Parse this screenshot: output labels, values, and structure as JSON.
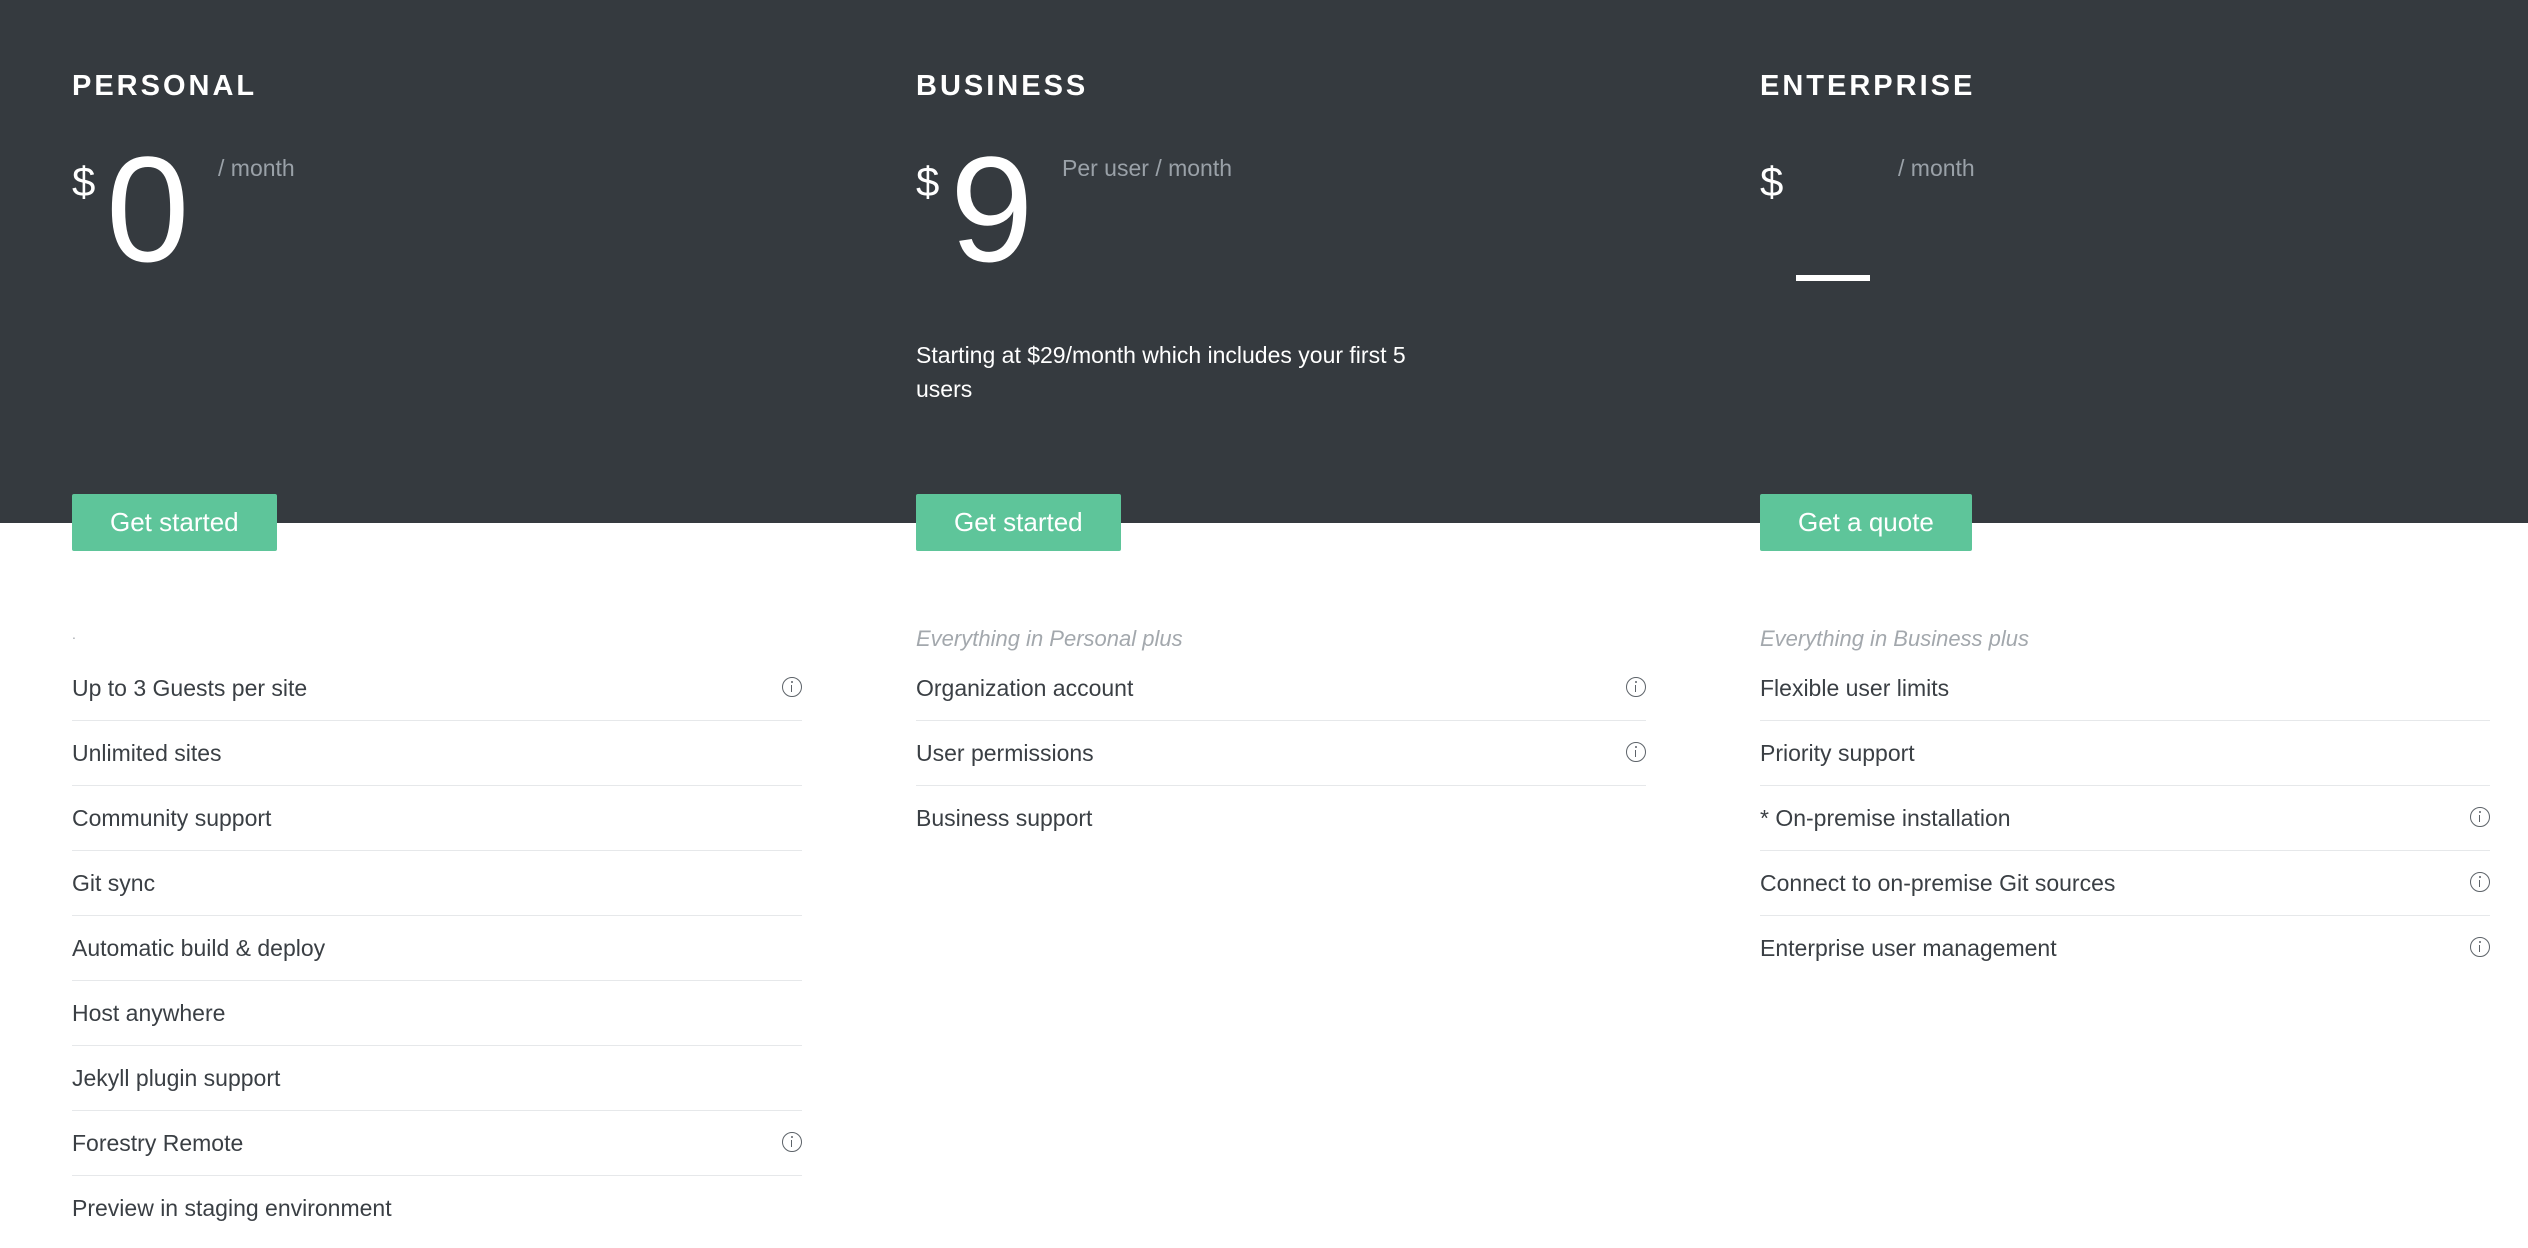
{
  "plans": [
    {
      "name": "PERSONAL",
      "currency": "$",
      "amount": "0",
      "period": "/ month",
      "note": "",
      "cta_label": "Get started",
      "features_intro": ".",
      "features": [
        {
          "label": "Up to 3 Guests per site",
          "info": true
        },
        {
          "label": "Unlimited sites",
          "info": false
        },
        {
          "label": "Community support",
          "info": false
        },
        {
          "label": "Git sync",
          "info": false
        },
        {
          "label": "Automatic build & deploy",
          "info": false
        },
        {
          "label": "Host anywhere",
          "info": false
        },
        {
          "label": "Jekyll plugin support",
          "info": false
        },
        {
          "label": "Forestry Remote",
          "info": true
        },
        {
          "label": "Preview in staging environment",
          "info": false
        }
      ]
    },
    {
      "name": "BUSINESS",
      "currency": "$",
      "amount": "9",
      "period": "Per user / month",
      "note": "Starting at $29/month which includes your first 5 users",
      "cta_label": "Get started",
      "features_intro": "Everything in Personal plus",
      "features": [
        {
          "label": "Organization account",
          "info": true
        },
        {
          "label": "User permissions",
          "info": true
        },
        {
          "label": "Business support",
          "info": false
        }
      ]
    },
    {
      "name": "ENTERPRISE",
      "currency": "$",
      "amount": "",
      "period": "/ month",
      "note": "",
      "cta_label": "Get a quote",
      "features_intro": "Everything in Business plus",
      "features": [
        {
          "label": "Flexible user limits",
          "info": false
        },
        {
          "label": "Priority support",
          "info": false
        },
        {
          "label": "* On-premise installation",
          "info": true
        },
        {
          "label": "Connect to on-premise Git sources",
          "info": true
        },
        {
          "label": "Enterprise user management",
          "info": true
        }
      ]
    }
  ],
  "colors": {
    "header_bg": "#353a3f",
    "cta_bg": "#5ec59a",
    "muted_text": "#9aa1a8",
    "divider": "#e6e8ea"
  },
  "icons": {
    "feature_info": "info-icon"
  }
}
